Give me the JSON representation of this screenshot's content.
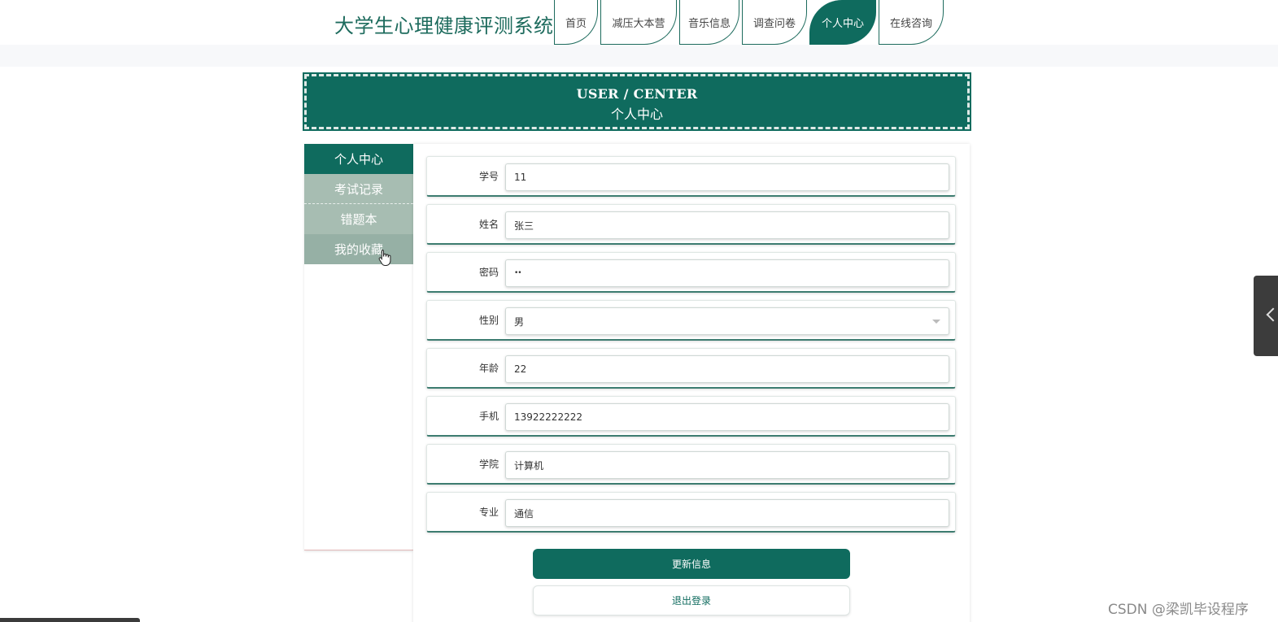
{
  "header": {
    "site_title": "大学生心理健康评测系统",
    "nav": [
      {
        "label": "首页",
        "active": false
      },
      {
        "label": "减压大本营",
        "active": false
      },
      {
        "label": "音乐信息",
        "active": false
      },
      {
        "label": "调查问卷",
        "active": false
      },
      {
        "label": "个人中心",
        "active": true
      },
      {
        "label": "在线咨询",
        "active": false
      }
    ]
  },
  "banner": {
    "title_en": "USER / CENTER",
    "title_cn": "个人中心"
  },
  "sidebar": {
    "items": [
      {
        "label": "个人中心",
        "active": true
      },
      {
        "label": "考试记录",
        "active": false
      },
      {
        "label": "错题本",
        "active": false
      },
      {
        "label": "我的收藏",
        "active": false
      }
    ]
  },
  "form": {
    "fields": [
      {
        "label": "学号",
        "value": "11",
        "type": "text"
      },
      {
        "label": "姓名",
        "value": "张三",
        "type": "text"
      },
      {
        "label": "密码",
        "value": "••",
        "type": "password"
      },
      {
        "label": "性别",
        "value": "男",
        "type": "select"
      },
      {
        "label": "年龄",
        "value": "22",
        "type": "text"
      },
      {
        "label": "手机",
        "value": "13922222222",
        "type": "text"
      },
      {
        "label": "学院",
        "value": "计算机",
        "type": "text"
      },
      {
        "label": "专业",
        "value": "通信",
        "type": "text"
      }
    ],
    "update_label": "更新信息",
    "logout_label": "退出登录"
  },
  "watermark": "CSDN @梁凯毕设程序",
  "colors": {
    "primary": "#0f6b5e",
    "sidebar_muted": "#a7bdb2"
  }
}
